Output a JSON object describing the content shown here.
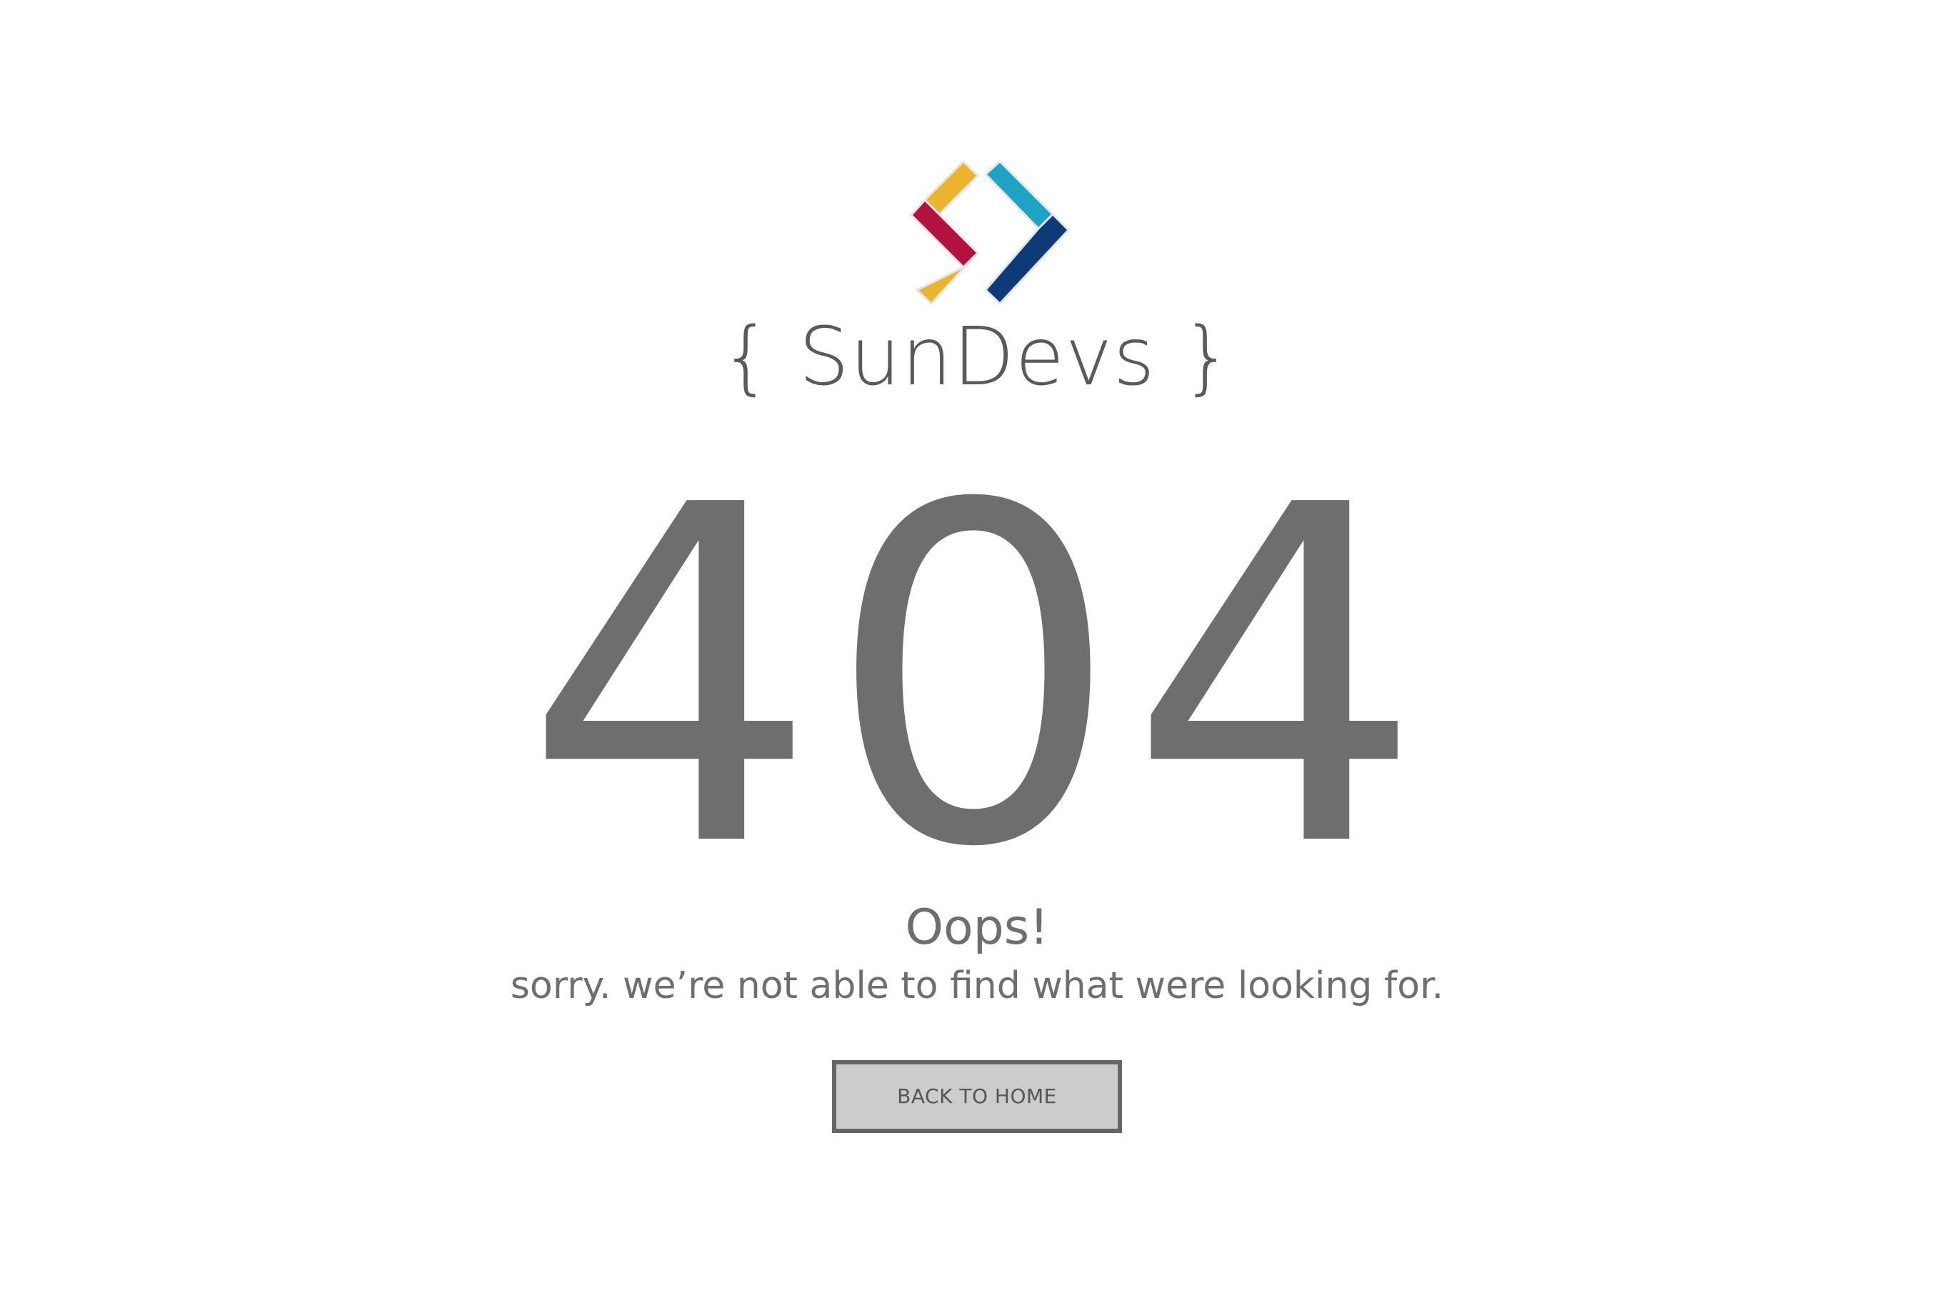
{
  "brand": {
    "name": "SunDevs",
    "brace_open": "{",
    "brace_close": "}",
    "logo_icon": "sundevs-chevron-logo-icon",
    "colors": {
      "yellow": "#E8B52C",
      "red": "#B3123E",
      "cyan": "#1EA3C4",
      "navy": "#0E3A78"
    }
  },
  "error": {
    "code": "404",
    "title": "Oops!",
    "message": "sorry. we’re not able to find what were looking for."
  },
  "actions": {
    "back_home_label": "BACK TO HOME"
  },
  "colors": {
    "text": "#6E6E6E",
    "button_bg": "#CCCCCC",
    "button_border": "#666666"
  }
}
